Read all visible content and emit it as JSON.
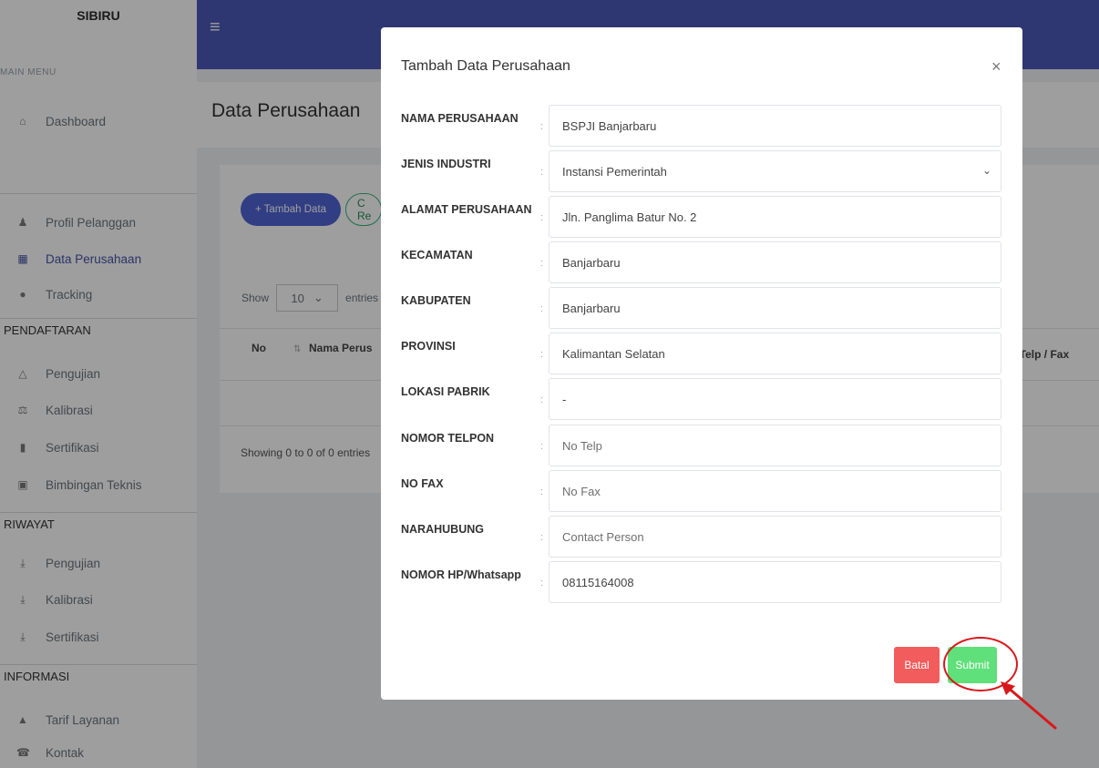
{
  "sidebar": {
    "brand": "SIBIRU",
    "main_menu_label": "MAIN MENU",
    "top_items": [
      {
        "label": "Dashboard",
        "icon": "home-icon"
      }
    ],
    "profile_items": [
      {
        "label": "Profil Pelanggan",
        "icon": "user-icon"
      },
      {
        "label": "Data Perusahaan",
        "icon": "building-icon",
        "active": true
      },
      {
        "label": "Tracking",
        "icon": "map-marker-icon"
      }
    ],
    "sections": {
      "pendaftaran": "PENDAFTARAN",
      "riwayat": "RIWAYAT",
      "informasi": "INFORMASI"
    },
    "pendaftaran_items": [
      {
        "label": "Pengujian",
        "icon": "flask-icon"
      },
      {
        "label": "Kalibrasi",
        "icon": "balance-scale-icon"
      },
      {
        "label": "Sertifikasi",
        "icon": "certificate-icon"
      },
      {
        "label": "Bimbingan Teknis",
        "icon": "briefcase-icon"
      }
    ],
    "riwayat_items": [
      {
        "label": "Pengujian",
        "icon": "download-icon"
      },
      {
        "label": "Kalibrasi",
        "icon": "download-icon"
      },
      {
        "label": "Sertifikasi",
        "icon": "download-icon"
      }
    ],
    "informasi_items": [
      {
        "label": "Tarif Layanan",
        "icon": "bell-icon"
      },
      {
        "label": "Kontak",
        "icon": "phone-icon"
      }
    ]
  },
  "header": {
    "accent_color": "#4c59b8"
  },
  "page": {
    "title": "Data Perusahaan",
    "tambah_button": "+ Tambah Data",
    "refresh_button_partial": "C Re",
    "show_label": "Show",
    "entries_value": "10",
    "entries_label": "entries",
    "columns": {
      "no": "No",
      "nama": "Nama Perus",
      "telp": "o Telp / Fax"
    },
    "showing_text": "Showing 0 to 0 of 0 entries"
  },
  "modal": {
    "title": "Tambah Data Perusahaan",
    "close_symbol": "×",
    "colon": ":",
    "fields": [
      {
        "label": "NAMA PERUSAHAAN",
        "value": "BSPJI Banjarbaru",
        "placeholder": false
      },
      {
        "label": "JENIS INDUSTRI",
        "value": "Instansi Pemerintah",
        "placeholder": false,
        "select": true
      },
      {
        "label": "ALAMAT PERUSAHAAN",
        "value": "Jln. Panglima Batur No. 2",
        "placeholder": false
      },
      {
        "label": "KECAMATAN",
        "value": "Banjarbaru",
        "placeholder": false
      },
      {
        "label": "KABUPATEN",
        "value": "Banjarbaru",
        "placeholder": false
      },
      {
        "label": "PROVINSI",
        "value": "Kalimantan Selatan",
        "placeholder": false
      },
      {
        "label": "LOKASI PABRIK",
        "value": "-",
        "placeholder": false
      },
      {
        "label": "NOMOR TELPON",
        "value": "No Telp",
        "placeholder": true
      },
      {
        "label": "NO FAX",
        "value": "No Fax",
        "placeholder": true
      },
      {
        "label": "NARAHUBUNG",
        "value": "Contact Person",
        "placeholder": true
      },
      {
        "label": "NOMOR HP/Whatsapp",
        "value": "08115164008",
        "placeholder": false
      }
    ],
    "batal_button": "Batal",
    "submit_button": "Submit",
    "submit_color": "#5fe07a",
    "batal_color": "#f25c5c",
    "highlight_color": "#d7191c"
  }
}
